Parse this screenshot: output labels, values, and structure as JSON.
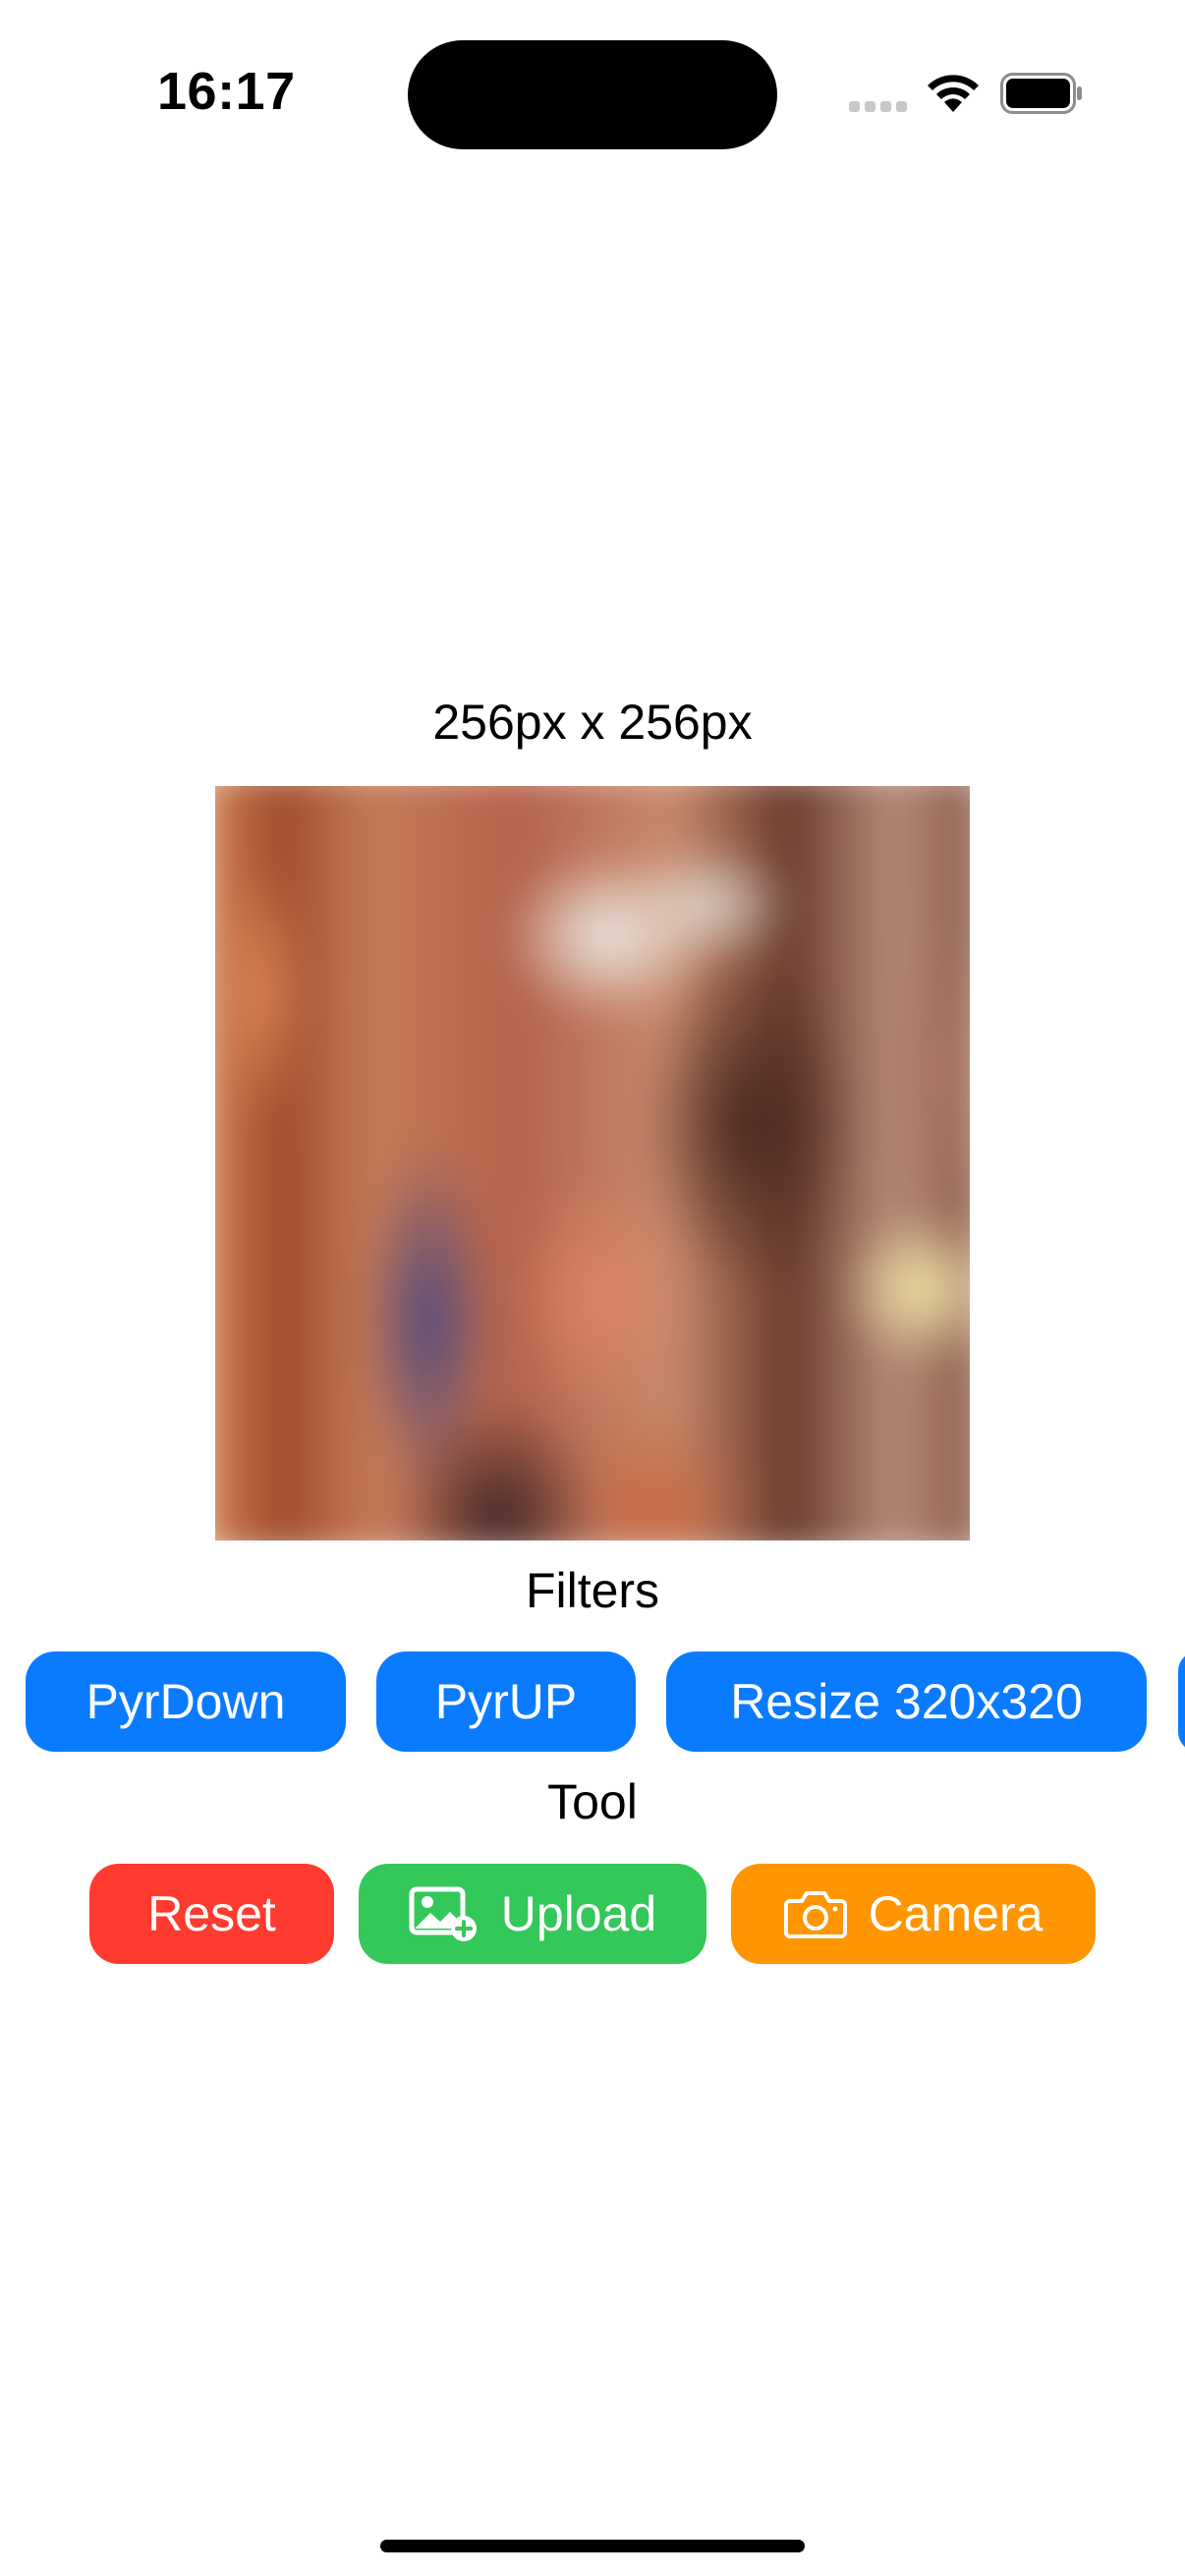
{
  "status_bar": {
    "time": "16:17"
  },
  "image": {
    "size_label": "256px x 256px"
  },
  "filters": {
    "title": "Filters",
    "buttons": [
      "PyrDown",
      "PyrUP",
      "Resize 320x320"
    ]
  },
  "tool": {
    "title": "Tool",
    "reset_label": "Reset",
    "upload_label": "Upload",
    "camera_label": "Camera"
  },
  "colors": {
    "filter_button": "#0a7bff",
    "reset_button": "#ff3b30",
    "upload_button": "#34c759",
    "camera_button": "#ff9500"
  },
  "icons": {
    "upload": "photo-badge-plus-icon",
    "camera": "camera-icon"
  }
}
